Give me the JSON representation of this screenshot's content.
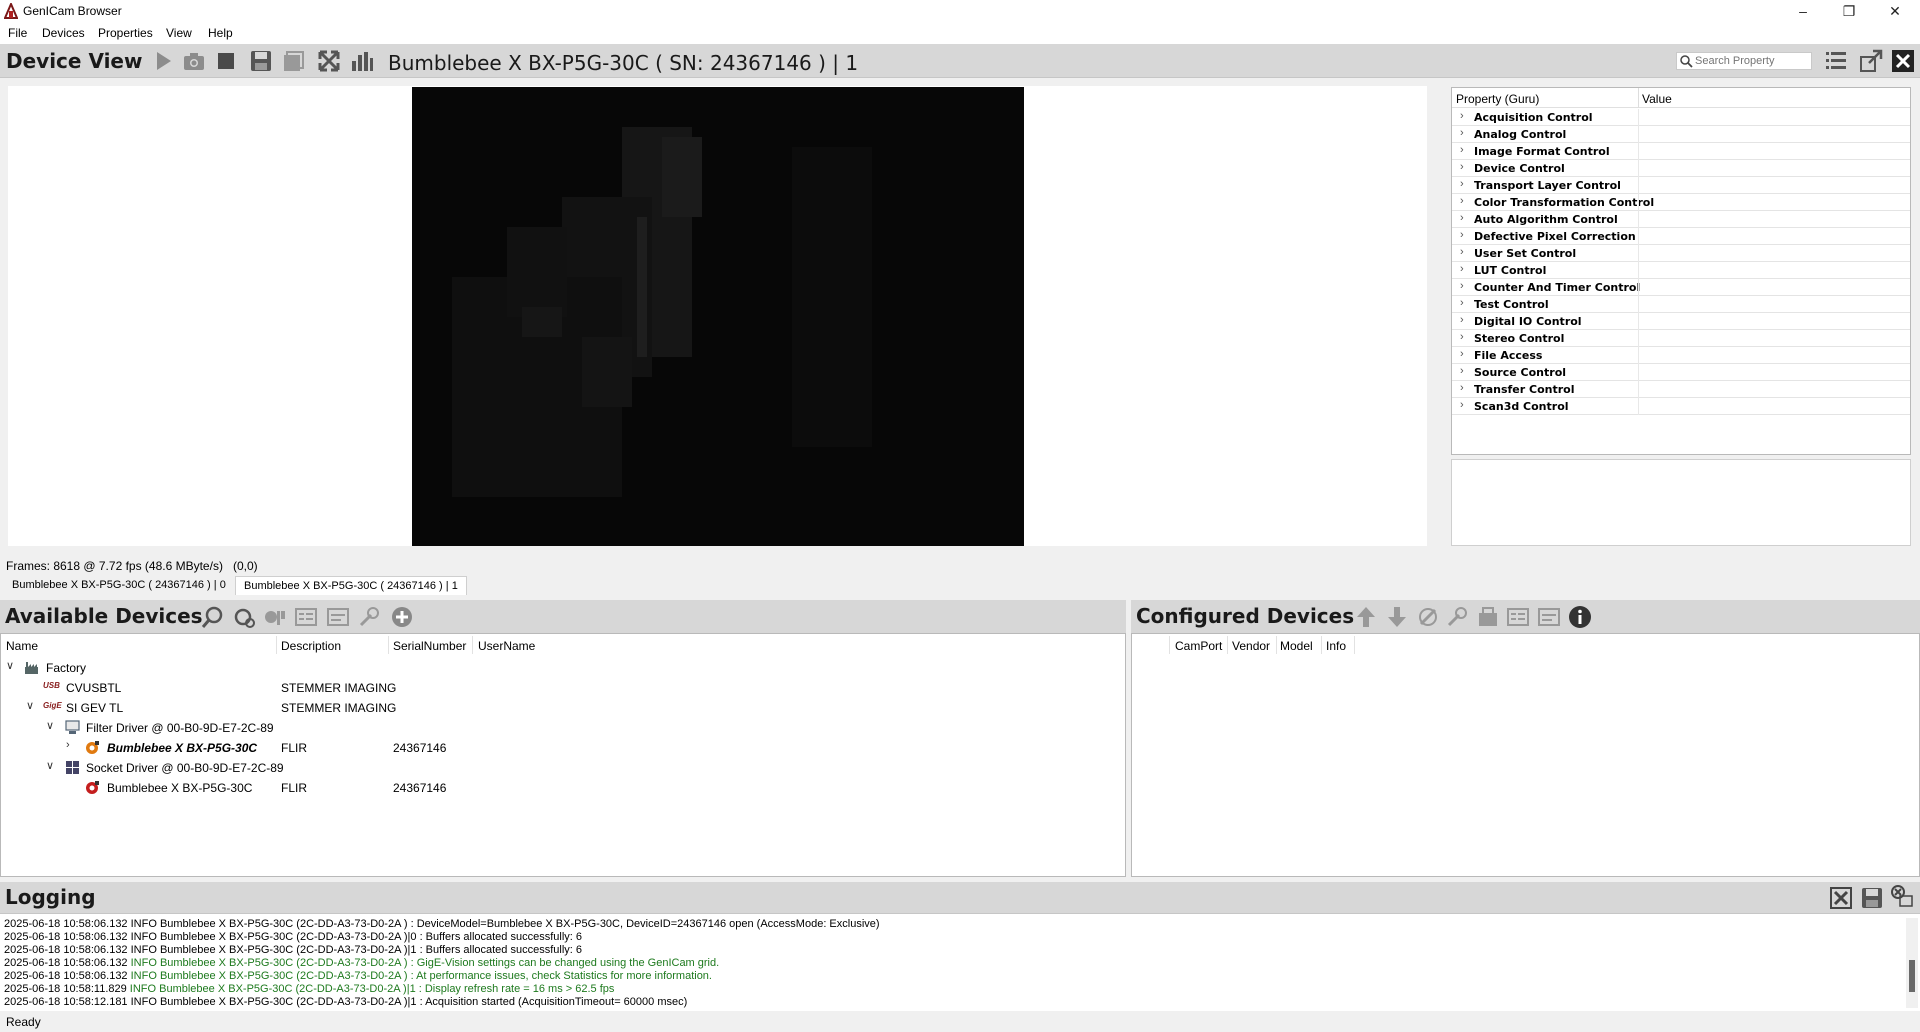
{
  "window": {
    "title": "GenICam Browser"
  },
  "menu": [
    "File",
    "Devices",
    "Properties",
    "View",
    "Help"
  ],
  "device_view": {
    "title": "Device View",
    "device_caption": "Bumblebee X BX-P5G-30C ( SN: 24367146 ) | 1",
    "search_placeholder": "Search Property"
  },
  "property_grid": {
    "col_property": "Property (Guru)",
    "col_value": "Value",
    "categories": [
      "Acquisition Control",
      "Analog Control",
      "Image Format Control",
      "Device Control",
      "Transport Layer Control",
      "Color Transformation Control",
      "Auto Algorithm Control",
      "Defective Pixel Correction",
      "User Set Control",
      "LUT Control",
      "Counter And Timer Control",
      "Test Control",
      "Digital IO Control",
      "Stereo Control",
      "File Access",
      "Source Control",
      "Transfer Control",
      "Scan3d Control"
    ]
  },
  "status": {
    "frames": "Frames: 8618 @ 7.72 fps (48.6 MByte/s)",
    "coords": "(0,0)"
  },
  "tabs": [
    "Bumblebee X BX-P5G-30C ( 24367146 ) | 0",
    "Bumblebee X BX-P5G-30C ( 24367146 ) | 1"
  ],
  "available_devices": {
    "title": "Available Devices",
    "columns": [
      "Name",
      "Description",
      "SerialNumber",
      "UserName"
    ],
    "rows": [
      {
        "name": "Factory",
        "description": "",
        "serial": "",
        "icon": "factory-icon"
      },
      {
        "name": "CVUSBTL",
        "description": "STEMMER IMAGING",
        "serial": "",
        "icon": "usb3-icon"
      },
      {
        "name": "SI GEV TL",
        "description": "STEMMER IMAGING",
        "serial": "",
        "icon": "gige-icon"
      },
      {
        "name": "Filter Driver @ 00-B0-9D-E7-2C-89",
        "description": "",
        "serial": "",
        "icon": "filter-driver-icon"
      },
      {
        "name": "Bumblebee X BX-P5G-30C",
        "description": "FLIR",
        "serial": "24367146",
        "icon": "camera-open-icon"
      },
      {
        "name": "Socket Driver @ 00-B0-9D-E7-2C-89",
        "description": "",
        "serial": "",
        "icon": "socket-driver-icon"
      },
      {
        "name": "Bumblebee X BX-P5G-30C",
        "description": "FLIR",
        "serial": "24367146",
        "icon": "camera-locked-icon"
      }
    ]
  },
  "configured_devices": {
    "title": "Configured Devices",
    "columns": [
      "CamPort",
      "Vendor",
      "Model",
      "Info"
    ]
  },
  "logging": {
    "title": "Logging",
    "lines": [
      {
        "prefix": "2025-06-18 10:58:06.132 ",
        "msg": "INFO Bumblebee X BX-P5G-30C (2C-DD-A3-73-D0-2A ) : DeviceModel=Bumblebee X BX-P5G-30C, DeviceID=24367146 open (AccessMode: Exclusive)",
        "green": false
      },
      {
        "prefix": "2025-06-18 10:58:06.132 ",
        "msg": "INFO Bumblebee X BX-P5G-30C (2C-DD-A3-73-D0-2A )|0 : Buffers allocated successfully: 6",
        "green": false
      },
      {
        "prefix": "2025-06-18 10:58:06.132 ",
        "msg": "INFO Bumblebee X BX-P5G-30C (2C-DD-A3-73-D0-2A )|1 : Buffers allocated successfully: 6",
        "green": false
      },
      {
        "prefix": "2025-06-18 10:58:06.132 ",
        "msg": "INFO Bumblebee X BX-P5G-30C (2C-DD-A3-73-D0-2A ) : GigE-Vision settings can be changed using the GenICam grid.",
        "green": true
      },
      {
        "prefix": "2025-06-18 10:58:06.132 ",
        "msg": "INFO Bumblebee X BX-P5G-30C (2C-DD-A3-73-D0-2A ) : At performance issues, check Statistics for more information.",
        "green": true
      },
      {
        "prefix": "2025-06-18 10:58:11.829 ",
        "msg": "INFO Bumblebee X BX-P5G-30C (2C-DD-A3-73-D0-2A )|1 : Display refresh rate = 16 ms > 62.5 fps",
        "green": true
      },
      {
        "prefix": "2025-06-18 10:58:12.181 ",
        "msg": "INFO Bumblebee X BX-P5G-30C (2C-DD-A3-73-D0-2A )|1 : Acquisition started (AcquisitionTimeout= 60000 msec)",
        "green": false
      }
    ]
  },
  "statusbar": {
    "text": "Ready"
  }
}
